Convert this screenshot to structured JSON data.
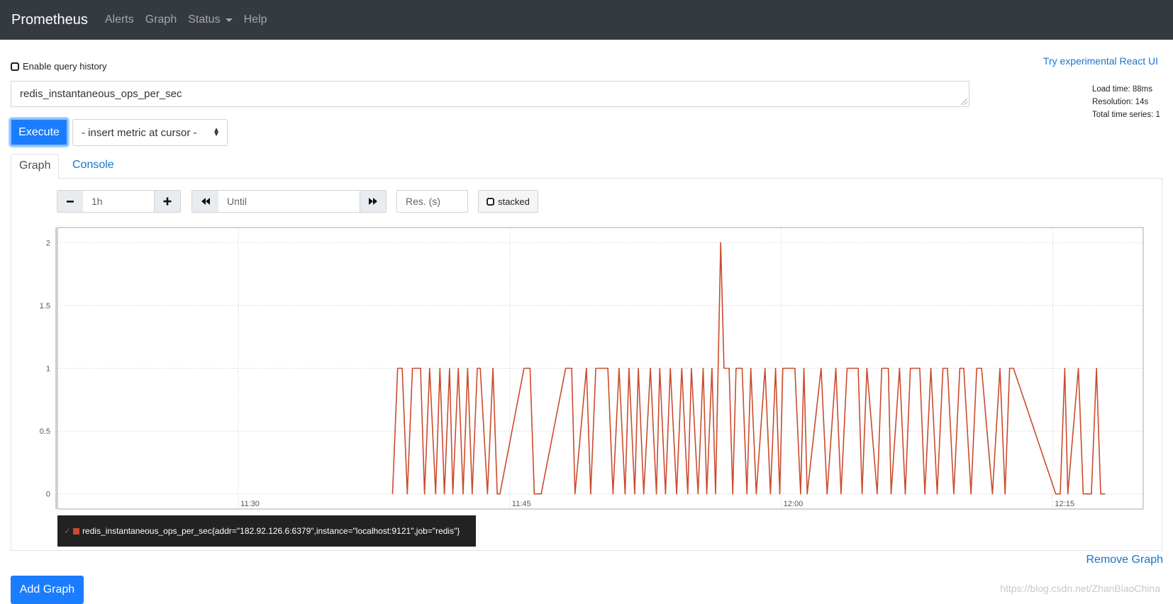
{
  "nav": {
    "brand": "Prometheus",
    "items": [
      {
        "label": "Alerts"
      },
      {
        "label": "Graph"
      },
      {
        "label": "Status"
      },
      {
        "label": "Help"
      }
    ]
  },
  "query_history_label": "Enable query history",
  "react_ui_link": "Try experimental React UI",
  "query": "redis_instantaneous_ops_per_sec",
  "stats": {
    "load_time": "Load time: 88ms",
    "resolution": "Resolution: 14s",
    "total_series": "Total time series: 1"
  },
  "execute_label": "Execute",
  "metric_select": "- insert metric at cursor -",
  "tabs": [
    {
      "label": "Graph",
      "active": true
    },
    {
      "label": "Console",
      "active": false
    }
  ],
  "controls": {
    "range": "1h",
    "until_placeholder": "Until",
    "res_placeholder": "Res. (s)",
    "stacked_label": "stacked",
    "minus": "−",
    "plus": "+"
  },
  "icons": {
    "minus": "minus-icon",
    "plus": "plus-icon",
    "backward": "backward-icon",
    "forward": "forward-icon",
    "select_arrows": "sort-icon",
    "legend_check": "check-icon"
  },
  "chart_data": {
    "type": "line",
    "color": "#cb4b2e",
    "yticks": [
      "0",
      "0.5",
      "1",
      "1.5",
      "2"
    ],
    "ylim": [
      -0.12,
      2.12
    ],
    "xlim": [
      "11:20",
      "12:20"
    ],
    "xticks": [
      "11:30",
      "11:45",
      "12:00",
      "12:15"
    ],
    "series": [
      {
        "name": "redis_instantaneous_ops_per_sec{addr=\"182.92.126.6:6379\",instance=\"localhost:9121\",job=\"redis\"}",
        "x": [
          "11:38:31",
          "11:38:48",
          "11:39:03",
          "11:39:20",
          "11:39:37",
          "11:40:04",
          "11:40:17",
          "11:40:34",
          "11:40:54",
          "11:41:08",
          "11:41:23",
          "11:41:40",
          "11:41:51",
          "11:42:09",
          "11:42:25",
          "11:42:40",
          "11:42:55",
          "11:43:12",
          "11:43:22",
          "11:43:46",
          "11:44:04",
          "11:44:18",
          "11:44:27",
          "11:45:47",
          "11:46:07",
          "11:46:21",
          "11:46:44",
          "11:48:05",
          "11:48:25",
          "11:48:36",
          "11:49:14",
          "11:49:28",
          "11:49:45",
          "11:50:25",
          "11:50:42",
          "11:51:02",
          "11:51:22",
          "11:51:35",
          "11:51:54",
          "11:52:06",
          "11:52:24",
          "11:52:46",
          "11:53:06",
          "11:53:17",
          "11:53:36",
          "11:53:52",
          "11:54:13",
          "11:54:30",
          "11:54:50",
          "11:55:02",
          "11:55:24",
          "11:55:41",
          "11:55:53",
          "11:56:10",
          "11:56:22",
          "11:56:39",
          "11:56:50",
          "11:57:07",
          "11:57:19",
          "11:57:30",
          "11:57:50",
          "11:58:06",
          "11:58:19",
          "11:58:37",
          "11:59:06",
          "11:59:24",
          "11:59:41",
          "11:59:55",
          "12:00:05",
          "12:00:45",
          "12:01:04",
          "12:01:15",
          "12:01:26",
          "12:02:12",
          "12:02:32",
          "12:03:01",
          "12:03:18",
          "12:03:38",
          "12:04:15",
          "12:04:28",
          "12:04:44",
          "12:05:18",
          "12:05:33",
          "12:05:55",
          "12:06:04",
          "12:06:32",
          "12:06:51",
          "12:07:08",
          "12:07:39",
          "12:07:56",
          "12:08:16",
          "12:08:37",
          "12:08:56",
          "12:09:11",
          "12:09:32",
          "12:09:52",
          "12:10:05",
          "12:10:29",
          "12:10:48",
          "12:11:04",
          "12:11:40",
          "12:12:05",
          "12:12:22",
          "12:12:37",
          "12:12:50",
          "12:15:10",
          "12:15:25",
          "12:15:40",
          "12:15:50",
          "12:16:25",
          "12:16:41",
          "12:17:08",
          "12:17:25",
          "12:17:39",
          "12:17:54"
        ],
        "y": [
          0,
          1,
          1,
          0,
          1,
          1,
          0,
          1,
          0,
          1,
          0,
          1,
          0,
          1,
          0,
          1,
          0,
          1,
          1,
          0,
          1,
          0,
          0,
          1,
          1,
          0,
          0,
          1,
          1,
          0,
          1,
          0,
          1,
          1,
          0,
          1,
          0,
          1,
          0,
          1,
          0,
          1,
          0,
          1,
          0,
          1,
          0,
          1,
          0,
          1,
          0,
          1,
          0,
          1,
          0,
          2,
          1,
          1,
          0,
          1,
          1,
          0,
          1,
          0,
          1,
          0,
          1,
          0,
          1,
          1,
          0,
          1,
          0,
          1,
          0,
          1,
          0,
          1,
          1,
          0,
          1,
          0,
          1,
          1,
          0,
          1,
          0,
          1,
          1,
          0,
          1,
          0,
          1,
          1,
          0,
          1,
          1,
          0,
          1,
          1,
          0,
          1,
          0,
          1,
          1,
          0,
          0,
          1,
          0,
          1,
          0,
          0,
          1,
          0,
          0
        ]
      }
    ]
  },
  "remove_graph": "Remove Graph",
  "add_graph": "Add Graph",
  "watermark": "https://blog.csdn.net/ZhanBiaoChina"
}
